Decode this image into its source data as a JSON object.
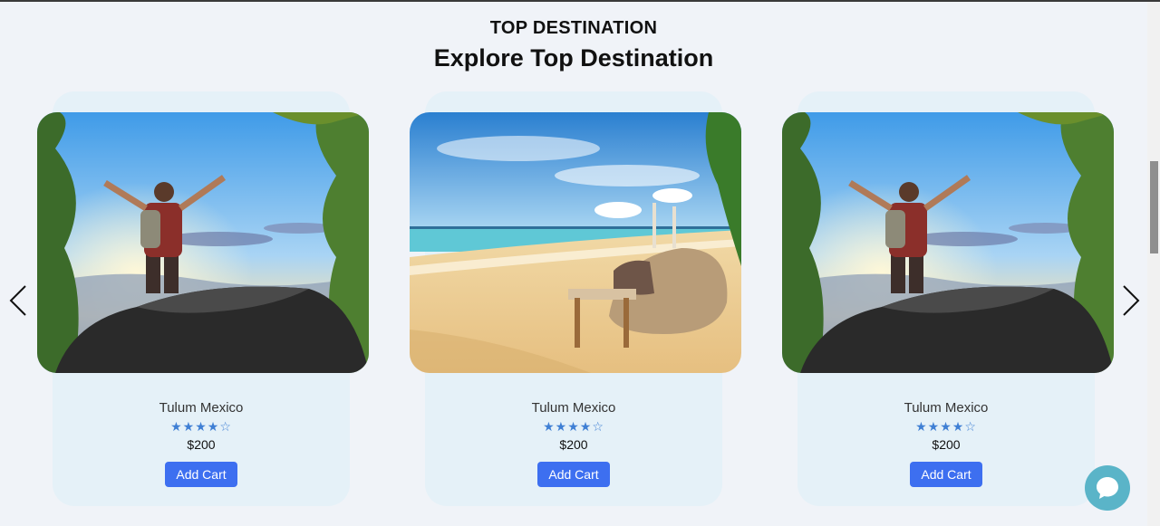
{
  "header": {
    "eyebrow": "TOP DESTINATION",
    "title": "Explore Top Destination"
  },
  "carousel": {
    "prev_icon": "chevron-left-icon",
    "next_icon": "chevron-right-icon",
    "cards": [
      {
        "title": "Tulum Mexico",
        "stars": "★★★★☆",
        "rating": 4,
        "price": "$200",
        "button": "Add Cart",
        "image": "hiker-on-rock"
      },
      {
        "title": "Tulum Mexico",
        "stars": "★★★★☆",
        "rating": 4,
        "price": "$200",
        "button": "Add Cart",
        "image": "beach-lounge"
      },
      {
        "title": "Tulum Mexico",
        "stars": "★★★★☆",
        "rating": 4,
        "price": "$200",
        "button": "Add Cart",
        "image": "hiker-on-rock"
      }
    ]
  },
  "chat": {
    "icon": "chat-bubble-icon"
  },
  "colors": {
    "background": "#f0f3f8",
    "card": "#e5f1f8",
    "button": "#3d6ff0",
    "star": "#3f7fd4",
    "chat": "#5ab4c8"
  }
}
